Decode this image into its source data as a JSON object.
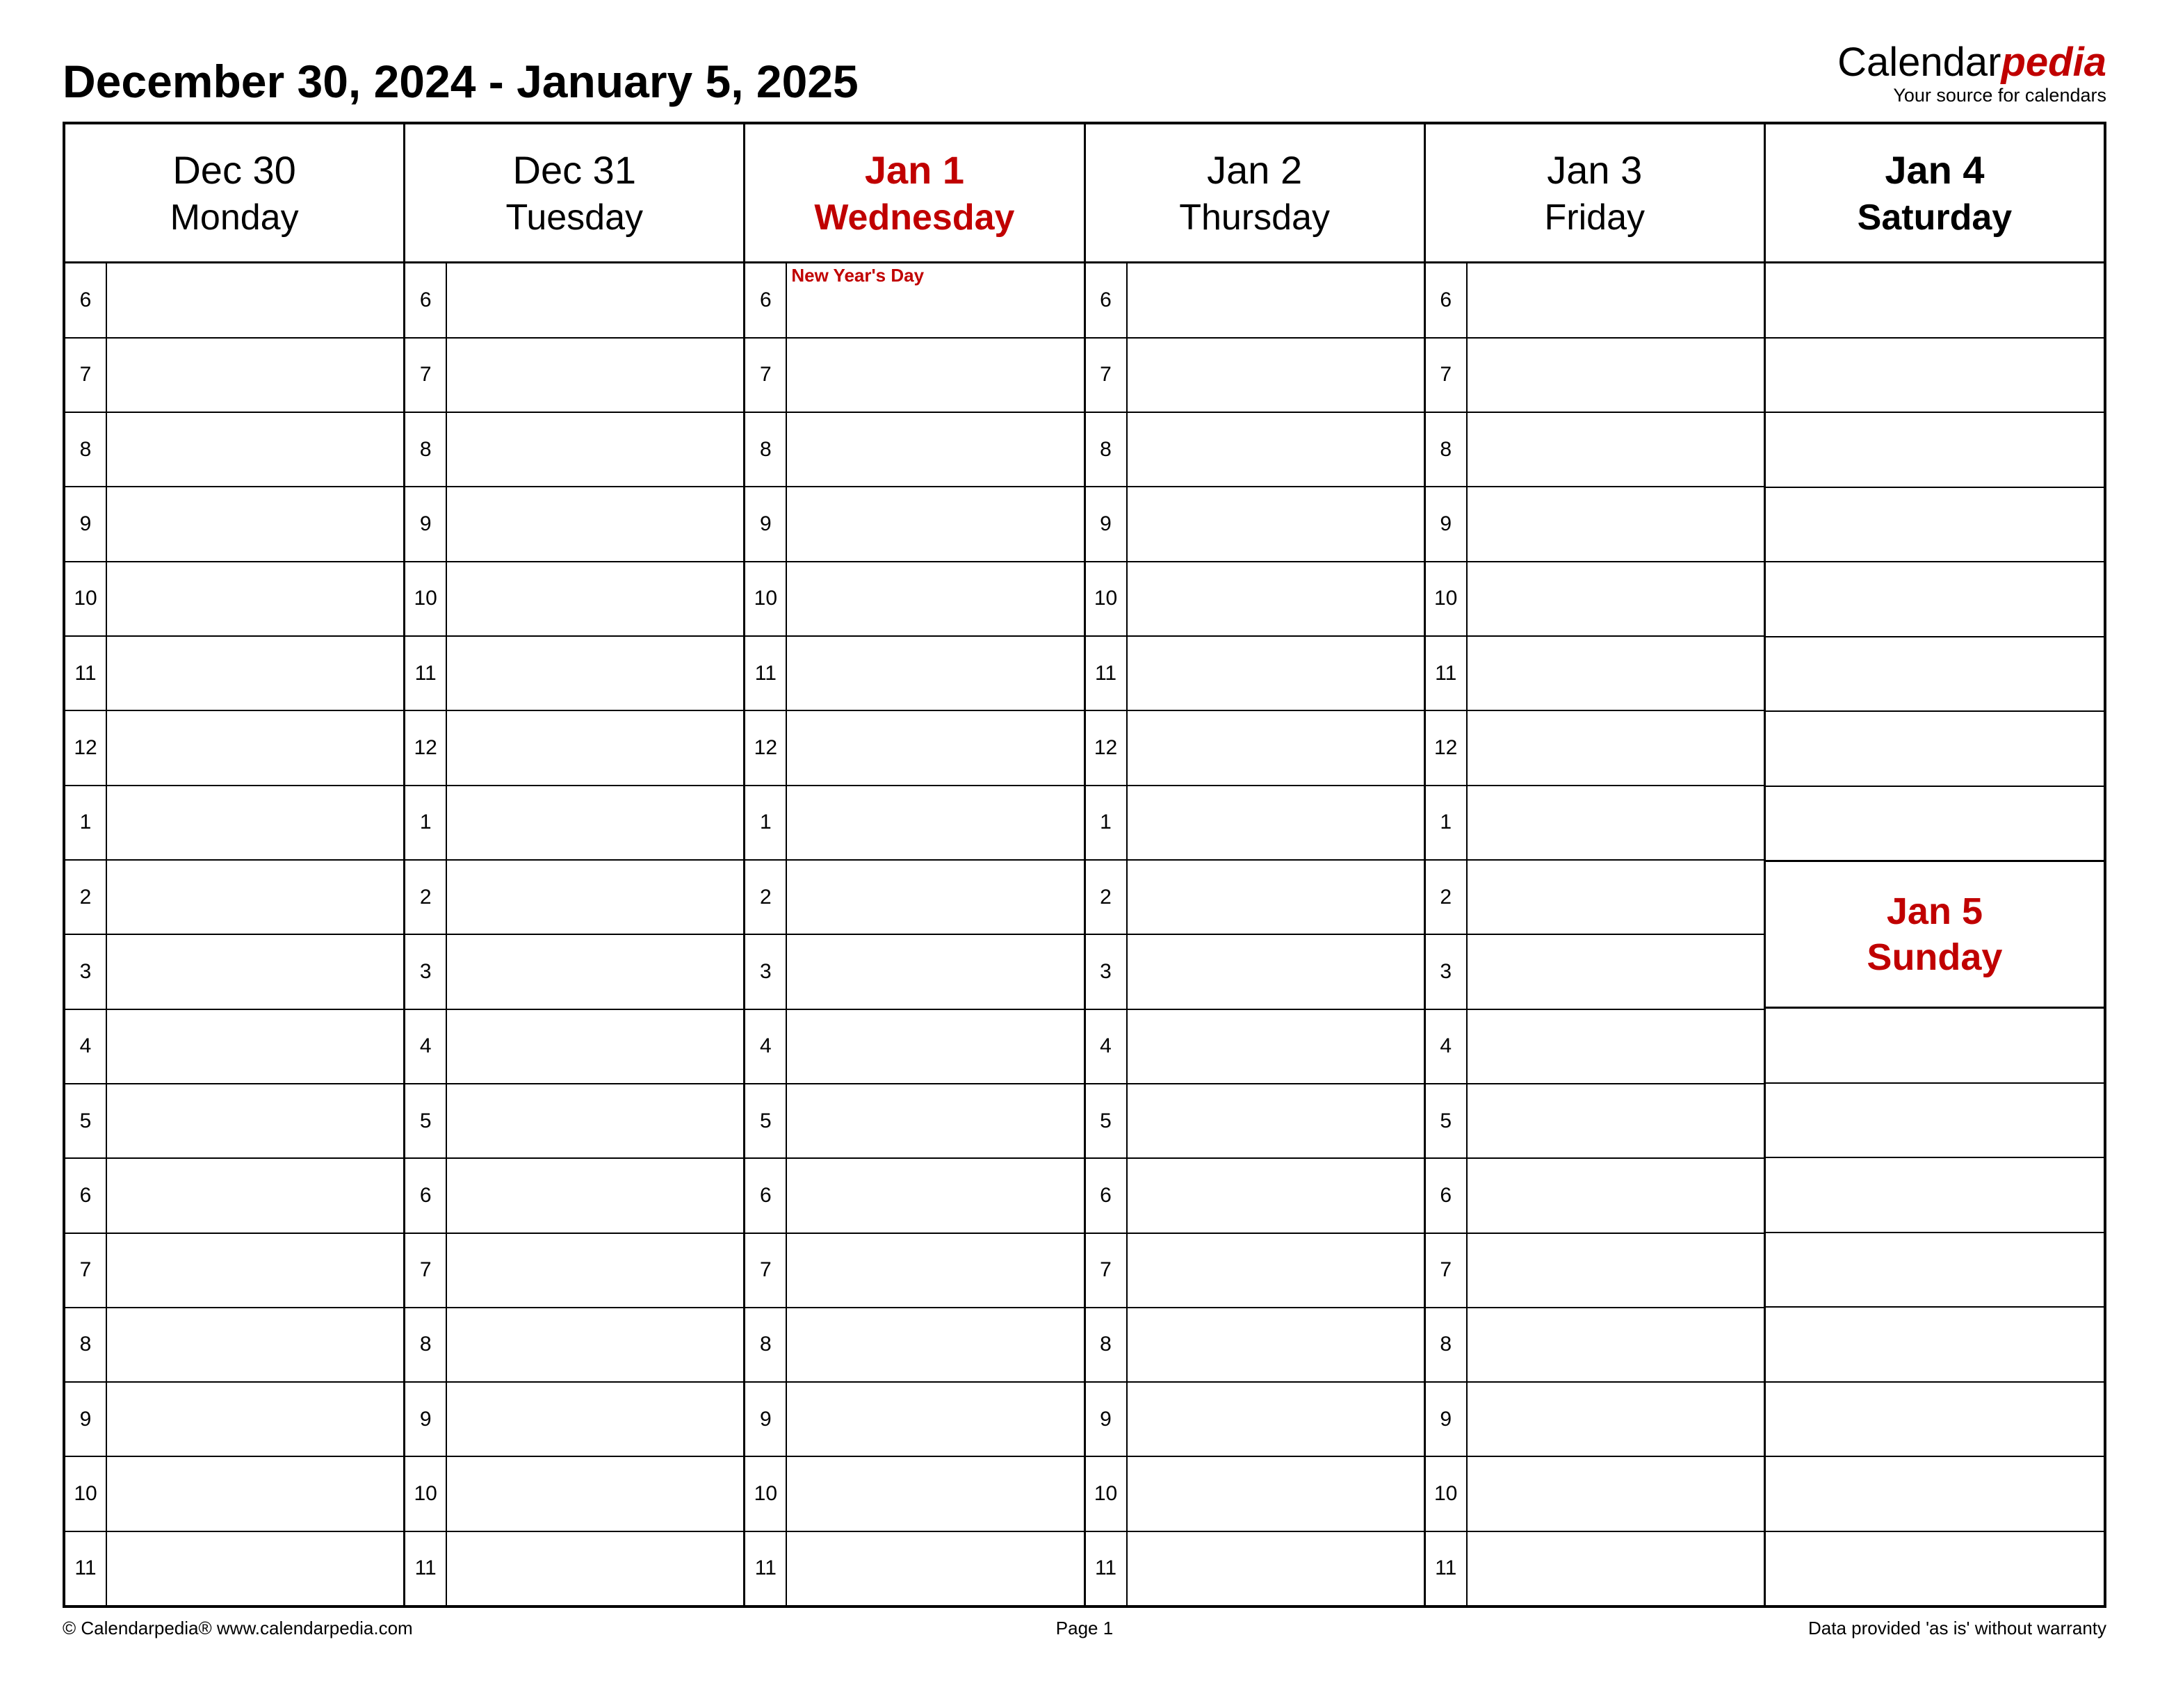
{
  "header": {
    "title": "December 30, 2024 - January 5, 2025",
    "brand_prefix": "Calendar",
    "brand_suffix": "pedia",
    "brand_tagline": "Your source for calendars"
  },
  "hours": [
    "6",
    "7",
    "8",
    "9",
    "10",
    "11",
    "12",
    "1",
    "2",
    "3",
    "4",
    "5",
    "6",
    "7",
    "8",
    "9",
    "10",
    "11"
  ],
  "weekday_columns": [
    {
      "date": "Dec 30",
      "day": "Monday",
      "style": "normal",
      "event": ""
    },
    {
      "date": "Dec 31",
      "day": "Tuesday",
      "style": "normal",
      "event": ""
    },
    {
      "date": "Jan 1",
      "day": "Wednesday",
      "style": "holiday",
      "event": "New Year's Day"
    },
    {
      "date": "Jan 2",
      "day": "Thursday",
      "style": "normal",
      "event": ""
    },
    {
      "date": "Jan 3",
      "day": "Friday",
      "style": "normal",
      "event": ""
    }
  ],
  "saturday": {
    "date": "Jan 4",
    "day": "Saturday"
  },
  "sunday": {
    "date": "Jan 5",
    "day": "Sunday"
  },
  "sat_row_count": 8,
  "sun_row_count": 8,
  "footer": {
    "left": "© Calendarpedia®   www.calendarpedia.com",
    "center": "Page 1",
    "right": "Data provided 'as is' without warranty"
  }
}
